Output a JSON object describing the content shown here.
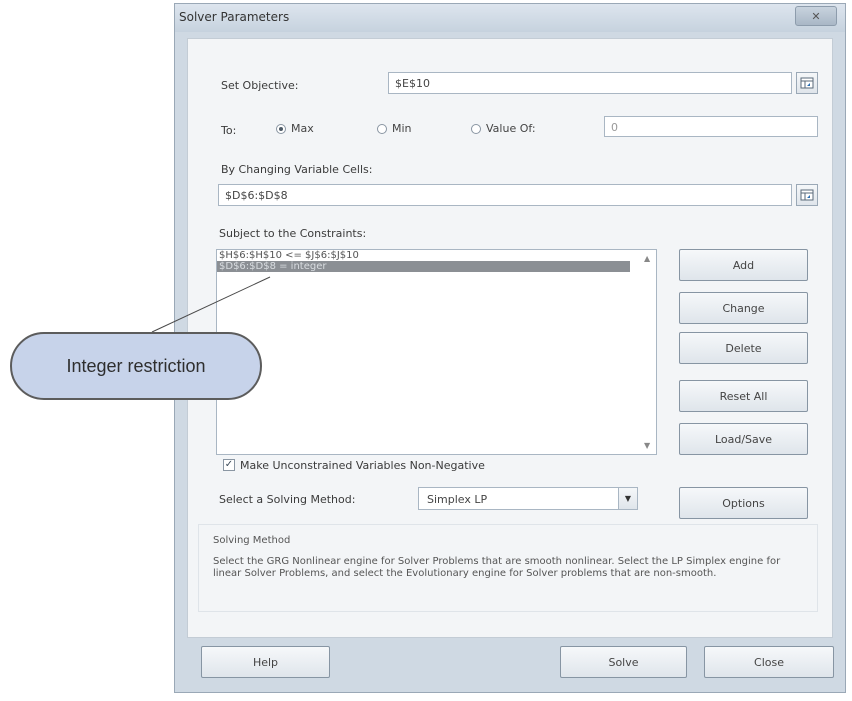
{
  "window": {
    "title": "Solver Parameters",
    "close_icon": "close-icon"
  },
  "objective": {
    "label": "Set Objective:",
    "value": "$E$10"
  },
  "to": {
    "label": "To:",
    "options": [
      {
        "label": "Max",
        "selected": true
      },
      {
        "label": "Min",
        "selected": false
      },
      {
        "label": "Value Of:",
        "selected": false
      }
    ],
    "value_of": "0"
  },
  "changing_cells": {
    "label": "By Changing Variable Cells:",
    "value": "$D$6:$D$8"
  },
  "constraints": {
    "label": "Subject to the Constraints:",
    "items": [
      {
        "text": "$H$6:$H$10 <= $J$6:$J$10",
        "selected": false
      },
      {
        "text": "$D$6:$D$8 = integer",
        "selected": true
      }
    ]
  },
  "side_buttons": {
    "add": "Add",
    "change": "Change",
    "delete": "Delete",
    "reset_all": "Reset All",
    "load_save": "Load/Save"
  },
  "nonnegative": {
    "label": "Make Unconstrained Variables Non-Negative",
    "checked": true
  },
  "method": {
    "label": "Select a Solving Method:",
    "value": "Simplex LP",
    "options_button": "Options",
    "heading": "Solving Method",
    "description": "Select the GRG Nonlinear engine for Solver Problems that are smooth nonlinear. Select the LP Simplex engine for linear Solver Problems, and select the Evolutionary engine for Solver problems that are non-smooth."
  },
  "bottom_buttons": {
    "help": "Help",
    "solve": "Solve",
    "close": "Close"
  },
  "callout": {
    "text": "Integer restriction"
  }
}
